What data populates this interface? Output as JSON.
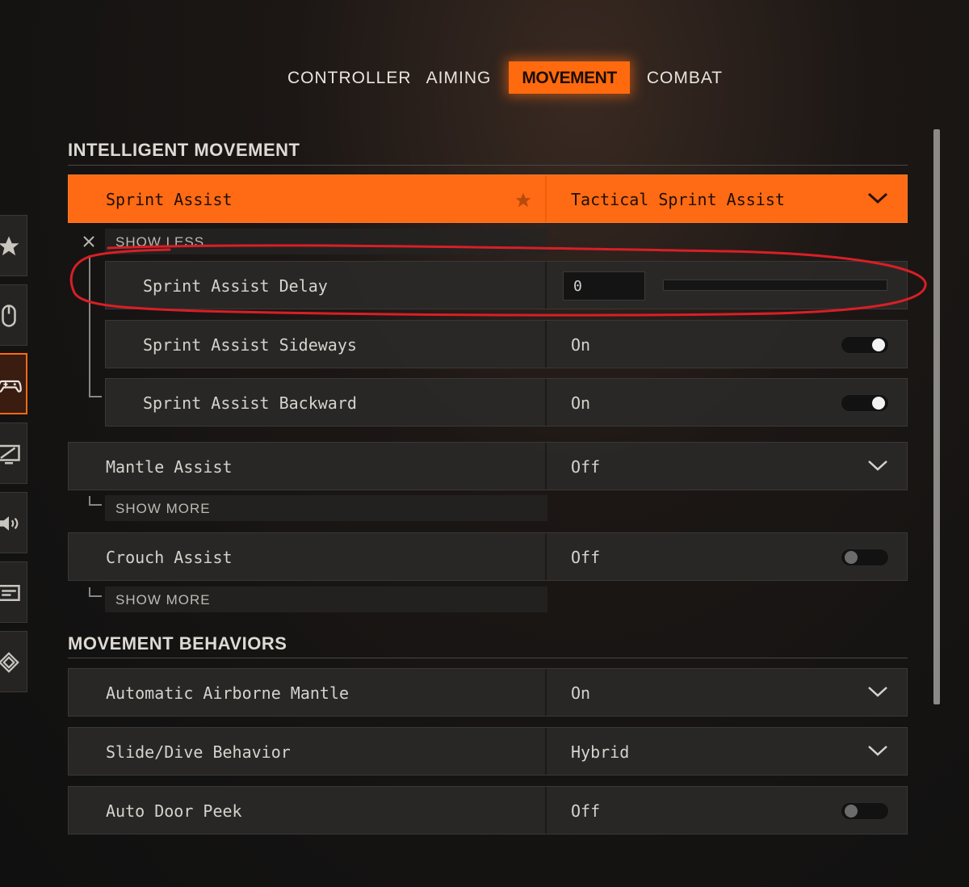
{
  "tabs": [
    {
      "label": "CONTROLLER",
      "active": false
    },
    {
      "label": "AIMING",
      "active": false
    },
    {
      "label": "MOVEMENT",
      "active": true
    },
    {
      "label": "COMBAT",
      "active": false
    }
  ],
  "sections": {
    "intelligent_movement": "INTELLIGENT MOVEMENT",
    "movement_behaviors": "MOVEMENT BEHAVIORS"
  },
  "rows": {
    "sprint_assist": {
      "label": "Sprint Assist",
      "value": "Tactical Sprint Assist",
      "icon": "star-icon"
    },
    "show_less": "SHOW LESS",
    "sprint_assist_delay": {
      "label": "Sprint Assist Delay",
      "value": "0",
      "slider_level": 0
    },
    "sprint_assist_sideways": {
      "label": "Sprint Assist Sideways",
      "value": "On"
    },
    "sprint_assist_backward": {
      "label": "Sprint Assist Backward",
      "value": "On"
    },
    "mantle_assist": {
      "label": "Mantle Assist",
      "value": "Off"
    },
    "mantle_show_more": "SHOW MORE",
    "crouch_assist": {
      "label": "Crouch Assist",
      "value": "Off"
    },
    "crouch_show_more": "SHOW MORE",
    "automatic_airborne_mantle": {
      "label": "Automatic Airborne Mantle",
      "value": "On"
    },
    "slide_dive_behavior": {
      "label": "Slide/Dive Behavior",
      "value": "Hybrid"
    },
    "auto_door_peek": {
      "label": "Auto Door Peek",
      "value": "Off"
    }
  },
  "sidebar_icons": [
    "star-icon",
    "mouse-icon",
    "gamepad-icon",
    "display-icon",
    "speaker-icon",
    "keyboard-icon",
    "network-icon"
  ],
  "colors": {
    "accent": "#ff6a14",
    "annotation": "#d81f26"
  }
}
